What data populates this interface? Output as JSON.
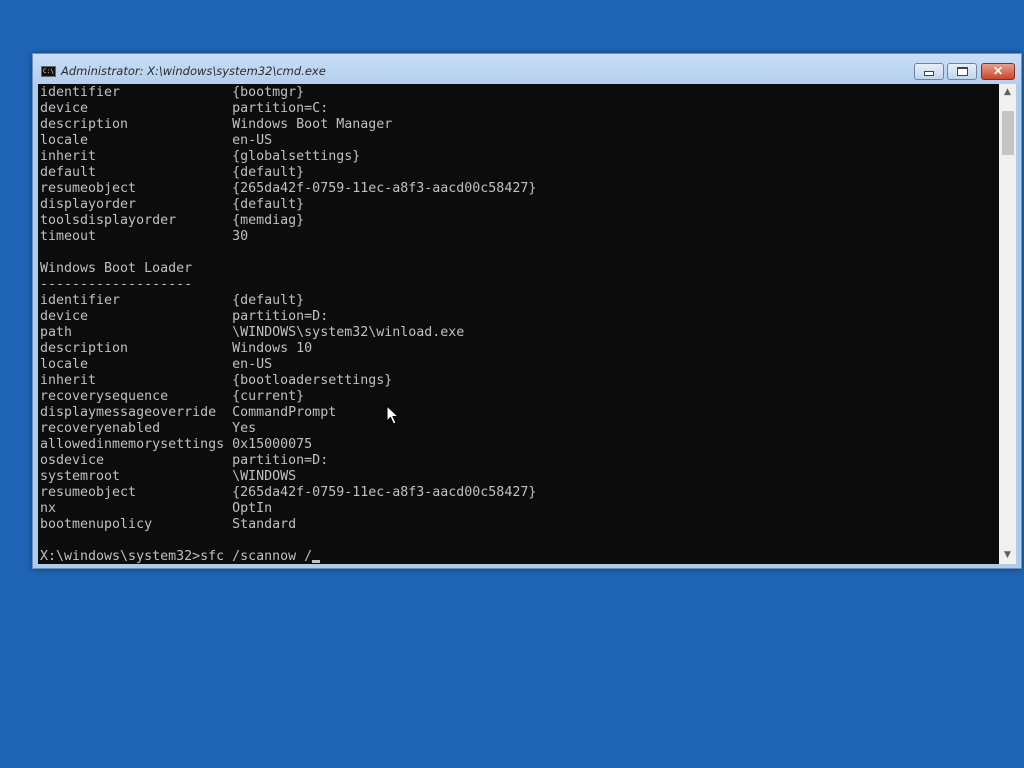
{
  "window": {
    "title": "Administrator: X:\\windows\\system32\\cmd.exe",
    "icon_label": "C:\\",
    "icon": "cmd-icon",
    "controls": {
      "minimize": "minimize-icon",
      "maximize": "maximize-icon",
      "close": "close-icon",
      "close_glyph": "✕"
    }
  },
  "console": {
    "lines": [
      "identifier              {bootmgr}",
      "device                  partition=C:",
      "description             Windows Boot Manager",
      "locale                  en-US",
      "inherit                 {globalsettings}",
      "default                 {default}",
      "resumeobject            {265da42f-0759-11ec-a8f3-aacd00c58427}",
      "displayorder            {default}",
      "toolsdisplayorder       {memdiag}",
      "timeout                 30",
      "",
      "Windows Boot Loader",
      "-------------------",
      "identifier              {default}",
      "device                  partition=D:",
      "path                    \\WINDOWS\\system32\\winload.exe",
      "description             Windows 10",
      "locale                  en-US",
      "inherit                 {bootloadersettings}",
      "recoverysequence        {current}",
      "displaymessageoverride  CommandPrompt",
      "recoveryenabled         Yes",
      "allowedinmemorysettings 0x15000075",
      "osdevice                partition=D:",
      "systemroot              \\WINDOWS",
      "resumeobject            {265da42f-0759-11ec-a8f3-aacd00c58427}",
      "nx                      OptIn",
      "bootmenupolicy          Standard",
      "",
      "X:\\windows\\system32>sfc /scannow /"
    ],
    "foreground": "#c0c0c0",
    "background": "#0c0c0c"
  },
  "scrollbar": {
    "up_glyph": "▲",
    "down_glyph": "▼"
  },
  "colors": {
    "desktop": "#1f64b4",
    "close_button": "#c7462d",
    "title_bar": "#b3cfee"
  }
}
